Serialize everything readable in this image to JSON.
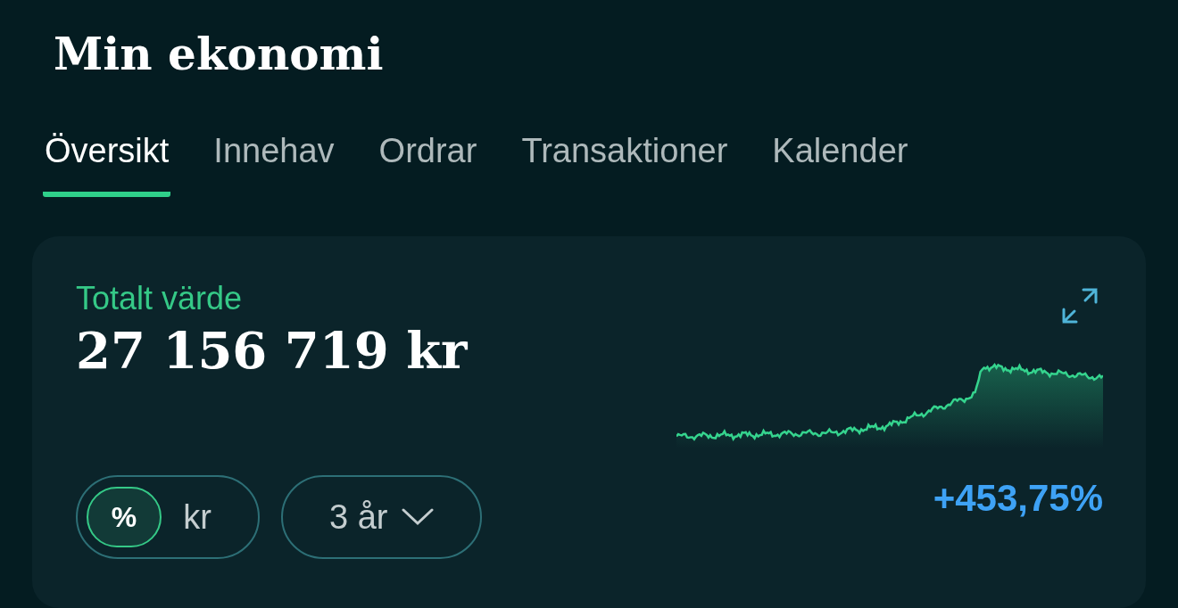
{
  "title": "Min ekonomi",
  "tabs": [
    {
      "label": "Översikt",
      "selected": true
    },
    {
      "label": "Innehav",
      "selected": false
    },
    {
      "label": "Ordrar",
      "selected": false
    },
    {
      "label": "Transaktioner",
      "selected": false
    },
    {
      "label": "Kalender",
      "selected": false
    }
  ],
  "card": {
    "label": "Totalt värde",
    "value": "27 156 719 kr",
    "change": "+453,75%",
    "unit_toggle": [
      {
        "label": "%",
        "selected": true
      },
      {
        "label": "kr",
        "selected": false
      }
    ],
    "period": {
      "label": "3 år"
    }
  }
}
